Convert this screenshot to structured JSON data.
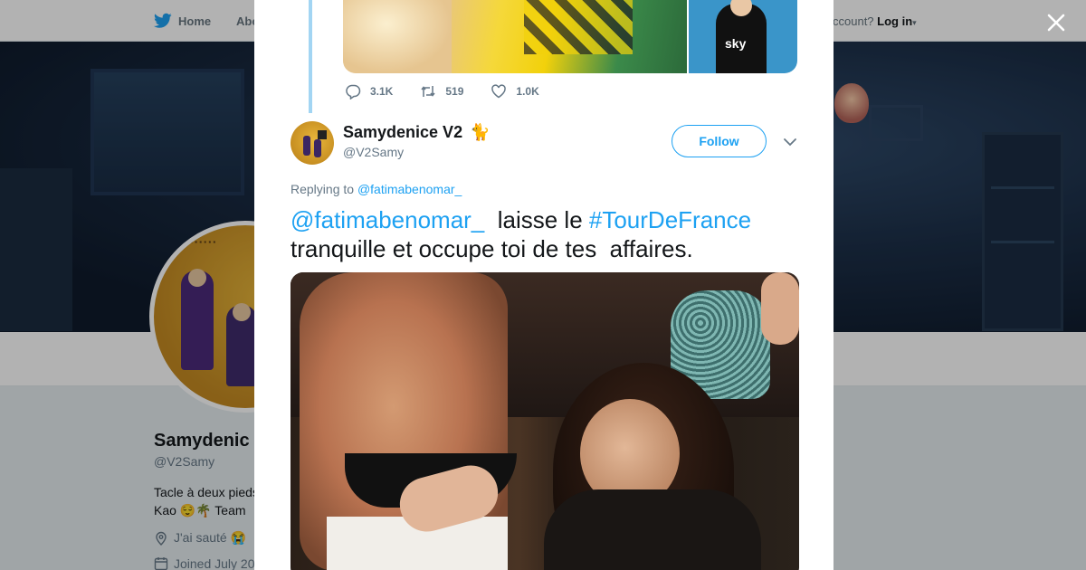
{
  "topbar": {
    "home_label": "Home",
    "about_label": "Abo",
    "account_prompt": "ccount?",
    "login_label": "Log in",
    "caret": "▾"
  },
  "profile": {
    "name": "Samydenic",
    "handle": "@V2Samy",
    "bio": "Tacle à deux pieds Kao 😌🌴 Team",
    "location": "J'ai sauté 😭",
    "joined": "Joined July 20"
  },
  "previous_tweet": {
    "replies": "3.1K",
    "retweets": "519",
    "likes": "1.0K",
    "image_caption": "sky"
  },
  "tweet": {
    "author_name": "Samydenice V2",
    "author_emoji": "🐈",
    "author_handle": "@V2Samy",
    "follow_label": "Follow",
    "replying_prefix": "Replying to",
    "replying_handle": "@fatimabenomar_",
    "text_mention": "@fatimabenomar_",
    "text_part1": "  laisse le ",
    "text_hashtag": "#TourDeFrance",
    "text_part2": "\ntranquille et occupe toi de tes  affaires."
  },
  "colors": {
    "brand_blue": "#1da1f2",
    "thread_line": "#a2d5f3",
    "muted_text": "#657786"
  },
  "icons": [
    "twitter-bird-icon",
    "close-icon",
    "reply-icon",
    "retweet-icon",
    "like-icon",
    "chevron-down-icon",
    "location-icon",
    "calendar-icon"
  ]
}
